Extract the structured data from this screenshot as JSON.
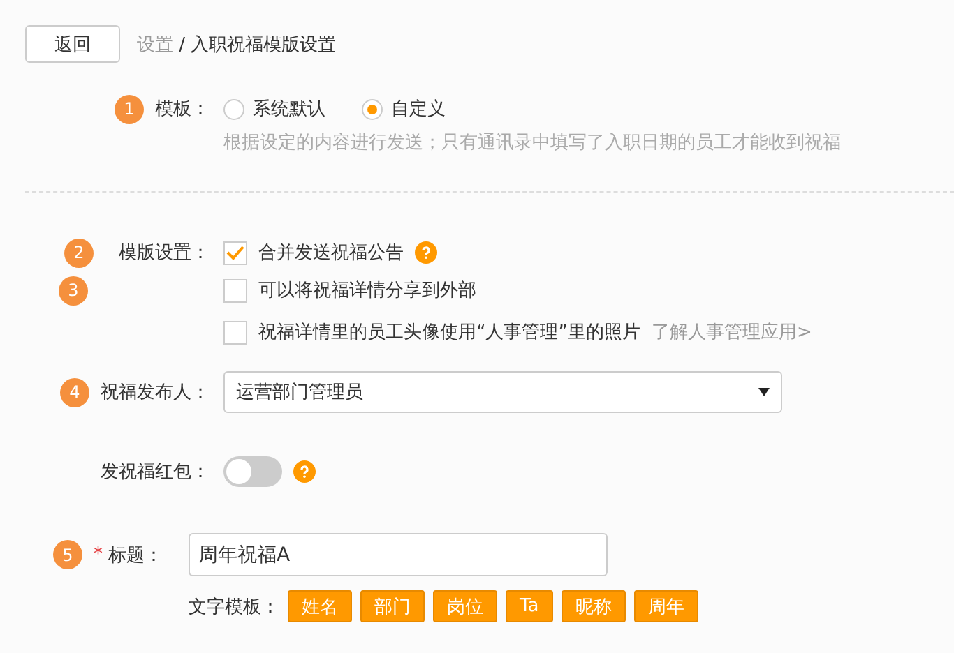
{
  "header": {
    "back_button": "返回",
    "breadcrumb": {
      "parent": "设置",
      "separator": "/",
      "current": "入职祝福模版设置"
    }
  },
  "template": {
    "step": "1",
    "label": "模板：",
    "options": [
      {
        "label": "系统默认",
        "selected": false
      },
      {
        "label": "自定义",
        "selected": true
      }
    ],
    "hint": "根据设定的内容进行发送；只有通讯录中填写了入职日期的员工才能收到祝福"
  },
  "template_settings": {
    "step": "2",
    "label": "模版设置：",
    "options": [
      {
        "label": "合并发送祝福公告",
        "checked": true,
        "help": true
      },
      {
        "step": "3",
        "label": "可以将祝福详情分享到外部",
        "checked": false,
        "help": false
      },
      {
        "label": "祝福详情里的员工头像使用“人事管理”里的照片",
        "checked": false,
        "help": false,
        "link": "了解人事管理应用>"
      }
    ]
  },
  "publisher": {
    "step": "4",
    "label": "祝福发布人：",
    "value": "运营部门管理员"
  },
  "red_packet": {
    "label": "发祝福红包：",
    "on": false
  },
  "title": {
    "step": "5",
    "required_marker": "*",
    "label": "标题：",
    "value": "周年祝福A"
  },
  "text_templates": {
    "label": "文字模板：",
    "tags": [
      "姓名",
      "部门",
      "岗位",
      "Ta",
      "昵称",
      "周年"
    ]
  }
}
